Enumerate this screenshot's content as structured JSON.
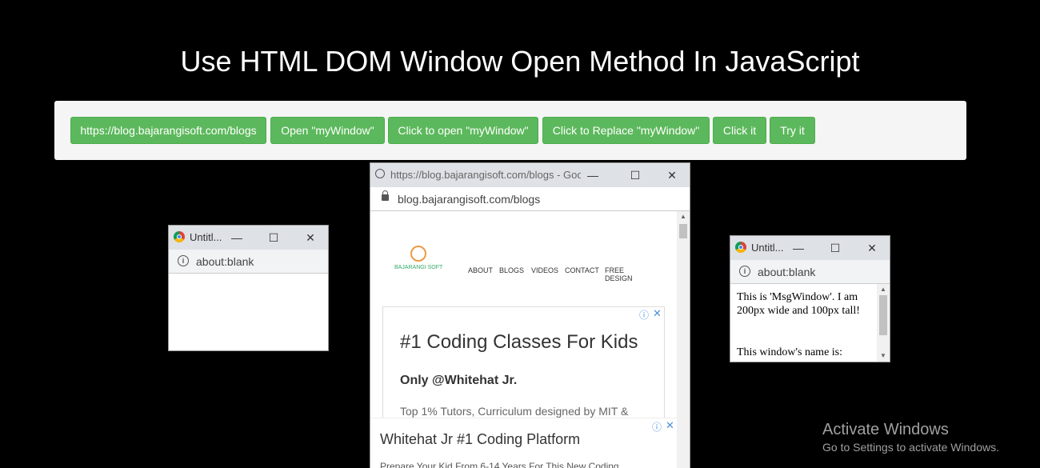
{
  "page": {
    "title": "Use HTML DOM Window Open Method In JavaScript"
  },
  "toolbar": {
    "buttons": [
      {
        "label": "https://blog.bajarangisoft.com/blogs"
      },
      {
        "label": "Open \"myWindow\""
      },
      {
        "label": "Click to open \"myWindow\""
      },
      {
        "label": "Click to Replace \"myWindow\""
      },
      {
        "label": "Click it"
      },
      {
        "label": "Try it"
      }
    ]
  },
  "popup_left": {
    "title": "Untitl...",
    "address": "about:blank"
  },
  "popup_center": {
    "title": "https://blog.bajarangisoft.com/blogs - Goo...",
    "address": "blog.bajarangisoft.com/blogs",
    "logo_text": "BAJARANGI SOFT",
    "nav": [
      "ABOUT",
      "BLOGS",
      "VIDEOS",
      "CONTACT",
      "FREE DESIGN"
    ],
    "ad1": {
      "headline": "#1 Coding Classes For Kids",
      "subhead": "Only @Whitehat Jr.",
      "body": "Top 1% Tutors, Curriculum designed by MIT &"
    },
    "ad2": {
      "headline": "Whitehat Jr #1 Coding Platform",
      "body": "Prepare Your Kid From 6-14 Years For This New Coding"
    }
  },
  "popup_right": {
    "title": "Untitl...",
    "address": "about:blank",
    "message_line1": "This is 'MsgWindow'. I am 200px wide and 100px tall!",
    "message_line2": "This window's name is:"
  },
  "watermark": {
    "line1": "Activate Windows",
    "line2": "Go to Settings to activate Windows."
  },
  "colors": {
    "button_bg": "#5cb85c",
    "toolbar_bg": "#f5f5f5",
    "page_bg": "#000000"
  }
}
